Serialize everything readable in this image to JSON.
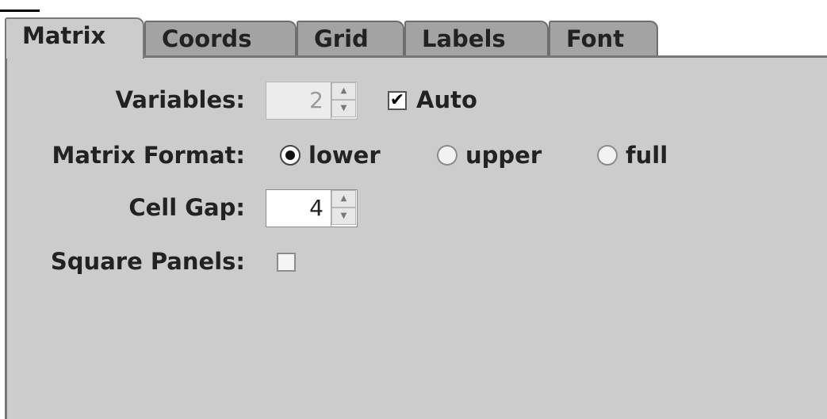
{
  "tabs": [
    {
      "label": "Matrix",
      "active": true
    },
    {
      "label": "Coords",
      "active": false
    },
    {
      "label": "Grid",
      "active": false
    },
    {
      "label": "Labels",
      "active": false
    },
    {
      "label": "Font",
      "active": false
    }
  ],
  "matrix": {
    "variables": {
      "label": "Variables:",
      "value": "2",
      "disabled": true
    },
    "auto": {
      "label": "Auto",
      "checked": true,
      "check_glyph": "✔"
    },
    "format": {
      "label": "Matrix Format:",
      "options": [
        {
          "label": "lower",
          "selected": true
        },
        {
          "label": "upper",
          "selected": false
        },
        {
          "label": "full",
          "selected": false
        }
      ]
    },
    "cell_gap": {
      "label": "Cell Gap:",
      "value": "4"
    },
    "square_panels": {
      "label": "Square Panels:",
      "checked": false
    }
  },
  "spinner_arrows": {
    "up": "▲",
    "down": "▼"
  },
  "colors": {
    "panel": "#cccccc",
    "tab_inactive": "#a3a3a3"
  }
}
